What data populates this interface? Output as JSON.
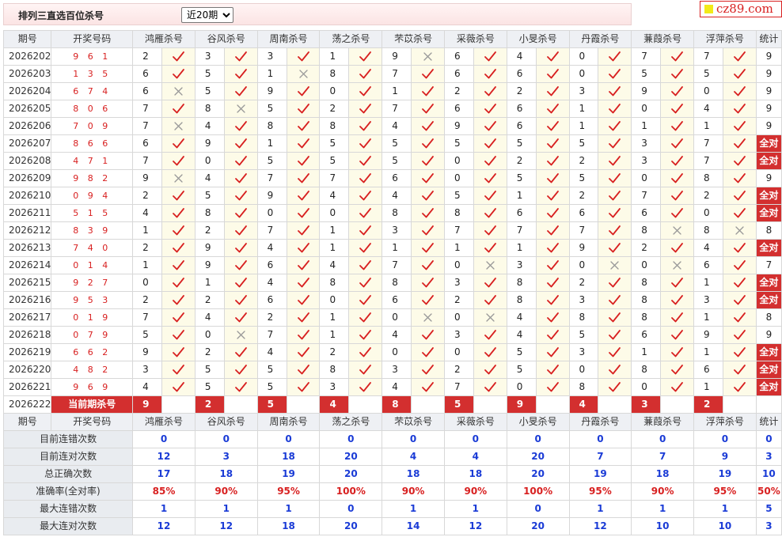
{
  "header": {
    "title": "排列三直选百位杀号",
    "period_select": "近20期",
    "logo_text": "cz89.com"
  },
  "columns": {
    "period": "期号",
    "winning": "开奖号码",
    "killers": [
      "鸿雁杀号",
      "谷风杀号",
      "周南杀号",
      "荡之杀号",
      "芣苡杀号",
      "采薇杀号",
      "小旻杀号",
      "丹霞杀号",
      "蒹葭杀号",
      "浮萍杀号"
    ],
    "total": "统计"
  },
  "rows": [
    {
      "period": "2026202",
      "num": "9 6 1",
      "k": [
        [
          2,
          1
        ],
        [
          3,
          1
        ],
        [
          3,
          1
        ],
        [
          1,
          1
        ],
        [
          9,
          0
        ],
        [
          6,
          1
        ],
        [
          4,
          1
        ],
        [
          0,
          1
        ],
        [
          7,
          1
        ],
        [
          7,
          1
        ]
      ],
      "total": "9"
    },
    {
      "period": "2026203",
      "num": "1 3 5",
      "k": [
        [
          6,
          1
        ],
        [
          5,
          1
        ],
        [
          1,
          0
        ],
        [
          8,
          1
        ],
        [
          7,
          1
        ],
        [
          6,
          1
        ],
        [
          6,
          1
        ],
        [
          0,
          1
        ],
        [
          5,
          1
        ],
        [
          5,
          1
        ]
      ],
      "total": "9"
    },
    {
      "period": "2026204",
      "num": "6 7 4",
      "k": [
        [
          6,
          0
        ],
        [
          5,
          1
        ],
        [
          9,
          1
        ],
        [
          0,
          1
        ],
        [
          1,
          1
        ],
        [
          2,
          1
        ],
        [
          2,
          1
        ],
        [
          3,
          1
        ],
        [
          9,
          1
        ],
        [
          0,
          1
        ]
      ],
      "total": "9"
    },
    {
      "period": "2026205",
      "num": "8 0 6",
      "k": [
        [
          7,
          1
        ],
        [
          8,
          0
        ],
        [
          5,
          1
        ],
        [
          2,
          1
        ],
        [
          7,
          1
        ],
        [
          6,
          1
        ],
        [
          6,
          1
        ],
        [
          1,
          1
        ],
        [
          0,
          1
        ],
        [
          4,
          1
        ]
      ],
      "total": "9"
    },
    {
      "period": "2026206",
      "num": "7 0 9",
      "k": [
        [
          7,
          0
        ],
        [
          4,
          1
        ],
        [
          8,
          1
        ],
        [
          8,
          1
        ],
        [
          4,
          1
        ],
        [
          9,
          1
        ],
        [
          6,
          1
        ],
        [
          1,
          1
        ],
        [
          1,
          1
        ],
        [
          1,
          1
        ]
      ],
      "total": "9"
    },
    {
      "period": "2026207",
      "num": "8 6 6",
      "k": [
        [
          6,
          1
        ],
        [
          9,
          1
        ],
        [
          1,
          1
        ],
        [
          5,
          1
        ],
        [
          5,
          1
        ],
        [
          5,
          1
        ],
        [
          5,
          1
        ],
        [
          5,
          1
        ],
        [
          3,
          1
        ],
        [
          7,
          1
        ]
      ],
      "total": "全对"
    },
    {
      "period": "2026208",
      "num": "4 7 1",
      "k": [
        [
          7,
          1
        ],
        [
          0,
          1
        ],
        [
          5,
          1
        ],
        [
          5,
          1
        ],
        [
          5,
          1
        ],
        [
          0,
          1
        ],
        [
          2,
          1
        ],
        [
          2,
          1
        ],
        [
          3,
          1
        ],
        [
          7,
          1
        ]
      ],
      "total": "全对"
    },
    {
      "period": "2026209",
      "num": "9 8 2",
      "k": [
        [
          9,
          0
        ],
        [
          4,
          1
        ],
        [
          7,
          1
        ],
        [
          7,
          1
        ],
        [
          6,
          1
        ],
        [
          0,
          1
        ],
        [
          5,
          1
        ],
        [
          5,
          1
        ],
        [
          0,
          1
        ],
        [
          8,
          1
        ]
      ],
      "total": "9"
    },
    {
      "period": "2026210",
      "num": "0 9 4",
      "k": [
        [
          2,
          1
        ],
        [
          5,
          1
        ],
        [
          9,
          1
        ],
        [
          4,
          1
        ],
        [
          4,
          1
        ],
        [
          5,
          1
        ],
        [
          1,
          1
        ],
        [
          2,
          1
        ],
        [
          7,
          1
        ],
        [
          2,
          1
        ]
      ],
      "total": "全对"
    },
    {
      "period": "2026211",
      "num": "5 1 5",
      "k": [
        [
          4,
          1
        ],
        [
          8,
          1
        ],
        [
          0,
          1
        ],
        [
          0,
          1
        ],
        [
          8,
          1
        ],
        [
          8,
          1
        ],
        [
          6,
          1
        ],
        [
          6,
          1
        ],
        [
          6,
          1
        ],
        [
          0,
          1
        ]
      ],
      "total": "全对"
    },
    {
      "period": "2026212",
      "num": "8 3 9",
      "k": [
        [
          1,
          1
        ],
        [
          2,
          1
        ],
        [
          7,
          1
        ],
        [
          1,
          1
        ],
        [
          3,
          1
        ],
        [
          7,
          1
        ],
        [
          7,
          1
        ],
        [
          7,
          1
        ],
        [
          8,
          0
        ],
        [
          8,
          0
        ]
      ],
      "total": "8"
    },
    {
      "period": "2026213",
      "num": "7 4 0",
      "k": [
        [
          2,
          1
        ],
        [
          9,
          1
        ],
        [
          4,
          1
        ],
        [
          1,
          1
        ],
        [
          1,
          1
        ],
        [
          1,
          1
        ],
        [
          1,
          1
        ],
        [
          9,
          1
        ],
        [
          2,
          1
        ],
        [
          4,
          1
        ]
      ],
      "total": "全对"
    },
    {
      "period": "2026214",
      "num": "0 1 4",
      "k": [
        [
          1,
          1
        ],
        [
          9,
          1
        ],
        [
          6,
          1
        ],
        [
          4,
          1
        ],
        [
          7,
          1
        ],
        [
          0,
          0
        ],
        [
          3,
          1
        ],
        [
          0,
          0
        ],
        [
          0,
          0
        ],
        [
          6,
          1
        ]
      ],
      "total": "7"
    },
    {
      "period": "2026215",
      "num": "9 2 7",
      "k": [
        [
          0,
          1
        ],
        [
          1,
          1
        ],
        [
          4,
          1
        ],
        [
          8,
          1
        ],
        [
          8,
          1
        ],
        [
          3,
          1
        ],
        [
          8,
          1
        ],
        [
          2,
          1
        ],
        [
          8,
          1
        ],
        [
          1,
          1
        ]
      ],
      "total": "全对"
    },
    {
      "period": "2026216",
      "num": "9 5 3",
      "k": [
        [
          2,
          1
        ],
        [
          2,
          1
        ],
        [
          6,
          1
        ],
        [
          0,
          1
        ],
        [
          6,
          1
        ],
        [
          2,
          1
        ],
        [
          8,
          1
        ],
        [
          3,
          1
        ],
        [
          8,
          1
        ],
        [
          3,
          1
        ]
      ],
      "total": "全对"
    },
    {
      "period": "2026217",
      "num": "0 1 9",
      "k": [
        [
          7,
          1
        ],
        [
          4,
          1
        ],
        [
          2,
          1
        ],
        [
          1,
          1
        ],
        [
          0,
          0
        ],
        [
          0,
          0
        ],
        [
          4,
          1
        ],
        [
          8,
          1
        ],
        [
          8,
          1
        ],
        [
          1,
          1
        ]
      ],
      "total": "8"
    },
    {
      "period": "2026218",
      "num": "0 7 9",
      "k": [
        [
          5,
          1
        ],
        [
          0,
          0
        ],
        [
          7,
          1
        ],
        [
          1,
          1
        ],
        [
          4,
          1
        ],
        [
          3,
          1
        ],
        [
          4,
          1
        ],
        [
          5,
          1
        ],
        [
          6,
          1
        ],
        [
          9,
          1
        ]
      ],
      "total": "9"
    },
    {
      "period": "2026219",
      "num": "6 6 2",
      "k": [
        [
          9,
          1
        ],
        [
          2,
          1
        ],
        [
          4,
          1
        ],
        [
          2,
          1
        ],
        [
          0,
          1
        ],
        [
          0,
          1
        ],
        [
          5,
          1
        ],
        [
          3,
          1
        ],
        [
          1,
          1
        ],
        [
          1,
          1
        ]
      ],
      "total": "全对"
    },
    {
      "period": "2026220",
      "num": "4 8 2",
      "k": [
        [
          3,
          1
        ],
        [
          5,
          1
        ],
        [
          5,
          1
        ],
        [
          8,
          1
        ],
        [
          3,
          1
        ],
        [
          2,
          1
        ],
        [
          5,
          1
        ],
        [
          0,
          1
        ],
        [
          8,
          1
        ],
        [
          6,
          1
        ]
      ],
      "total": "全对"
    },
    {
      "period": "2026221",
      "num": "9 6 9",
      "k": [
        [
          4,
          1
        ],
        [
          5,
          1
        ],
        [
          5,
          1
        ],
        [
          3,
          1
        ],
        [
          4,
          1
        ],
        [
          7,
          1
        ],
        [
          0,
          1
        ],
        [
          8,
          1
        ],
        [
          0,
          1
        ],
        [
          1,
          1
        ]
      ],
      "total": "全对"
    }
  ],
  "current": {
    "period": "2026222",
    "label": "当前期杀号",
    "values": [
      "9",
      "2",
      "5",
      "4",
      "8",
      "5",
      "9",
      "4",
      "3",
      "2"
    ]
  },
  "stats": [
    {
      "label": "目前连错次数",
      "values": [
        "0",
        "0",
        "0",
        "0",
        "0",
        "0",
        "0",
        "0",
        "0",
        "0"
      ],
      "total": "0"
    },
    {
      "label": "目前连对次数",
      "values": [
        "12",
        "3",
        "18",
        "20",
        "4",
        "4",
        "20",
        "7",
        "7",
        "9"
      ],
      "total": "3"
    },
    {
      "label": "总正确次数",
      "values": [
        "17",
        "18",
        "19",
        "20",
        "18",
        "18",
        "20",
        "19",
        "18",
        "19"
      ],
      "total": "10"
    },
    {
      "label": "准确率(全对率)",
      "values": [
        "85%",
        "90%",
        "95%",
        "100%",
        "90%",
        "90%",
        "100%",
        "95%",
        "90%",
        "95%"
      ],
      "total": "50%",
      "red": true
    },
    {
      "label": "最大连错次数",
      "values": [
        "1",
        "1",
        "1",
        "0",
        "1",
        "1",
        "0",
        "1",
        "1",
        "1"
      ],
      "total": "5"
    },
    {
      "label": "最大连对次数",
      "values": [
        "12",
        "12",
        "18",
        "20",
        "14",
        "12",
        "20",
        "12",
        "10",
        "10"
      ],
      "total": "3"
    }
  ],
  "colors": {
    "accent_red": "#d32f2f",
    "check": "#d82020",
    "cross": "#999999",
    "mark_bg": "#fdfbe8",
    "stat_blue": "#1a3bd6"
  }
}
